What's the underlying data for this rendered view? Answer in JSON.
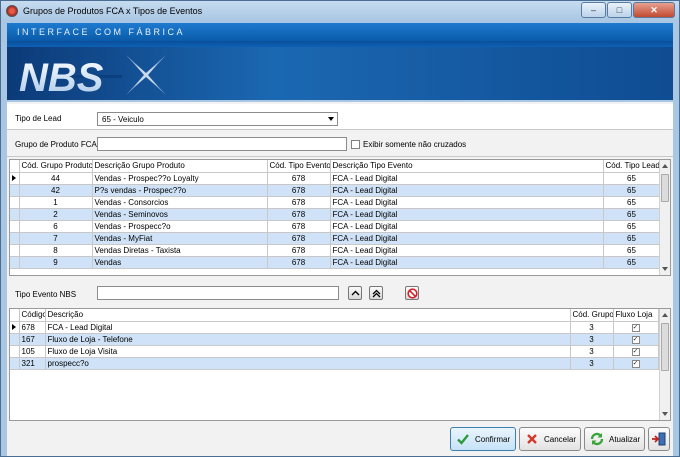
{
  "window": {
    "title": "Grupos de Produtos FCA x Tipos de Eventos",
    "controls": {
      "minimize": "–",
      "maximize": "□",
      "close": "✕"
    }
  },
  "banner": {
    "subtitle": "INTERFACE COM FÁBRICA",
    "logo_text": "NBS"
  },
  "filters": {
    "tipo_lead_label": "Tipo de Lead",
    "tipo_lead_value": "65 - Veiculo",
    "grupo_produto_label": "Grupo de Produto FCA",
    "grupo_produto_value": "",
    "exibir_label": "Exibir somente não cruzados"
  },
  "grid1": {
    "columns": [
      "Cód. Grupo Produto",
      "Descrição Grupo Produto",
      "Cód. Tipo Evento",
      "Descrição Tipo Evento",
      "Cód. Tipo Lead"
    ],
    "rows": [
      [
        "44",
        "Vendas - Prospec??o Loyalty",
        "678",
        "FCA - Lead Digital",
        "65"
      ],
      [
        "42",
        "P?s vendas - Prospec??o",
        "678",
        "FCA - Lead Digital",
        "65"
      ],
      [
        "1",
        "Vendas - Consorcios",
        "678",
        "FCA - Lead Digital",
        "65"
      ],
      [
        "2",
        "Vendas - Seminovos",
        "678",
        "FCA - Lead Digital",
        "65"
      ],
      [
        "6",
        "Vendas - Prospecc?o",
        "678",
        "FCA - Lead Digital",
        "65"
      ],
      [
        "7",
        "Vendas - MyFiat",
        "678",
        "FCA - Lead Digital",
        "65"
      ],
      [
        "8",
        "Vendas Diretas - Taxista",
        "678",
        "FCA - Lead Digital",
        "65"
      ],
      [
        "9",
        "Vendas",
        "678",
        "FCA - Lead Digital",
        "65"
      ]
    ]
  },
  "tipo_evento": {
    "label": "Tipo Evento NBS",
    "value": ""
  },
  "grid2": {
    "columns": [
      "Código",
      "Descrição",
      "Cód. Grupo",
      "Fluxo Loja"
    ],
    "rows": [
      {
        "codigo": "678",
        "descricao": "FCA - Lead Digital",
        "grupo": "3",
        "fluxo": "✓"
      },
      {
        "codigo": "167",
        "descricao": "Fluxo de Loja - Telefone",
        "grupo": "3",
        "fluxo": "✓"
      },
      {
        "codigo": "105",
        "descricao": "Fluxo de Loja Visita",
        "grupo": "3",
        "fluxo": "✓"
      },
      {
        "codigo": "321",
        "descricao": "prospecc?o",
        "grupo": "3",
        "fluxo": "✓"
      }
    ]
  },
  "buttons": {
    "confirmar": "Confirmar",
    "cancelar": "Cancelar",
    "atualizar": "Atualizar"
  },
  "colors": {
    "selected_row": "#cfe2f7",
    "banner": "#1b68b2",
    "confirm_border": "#3c7fb1"
  }
}
